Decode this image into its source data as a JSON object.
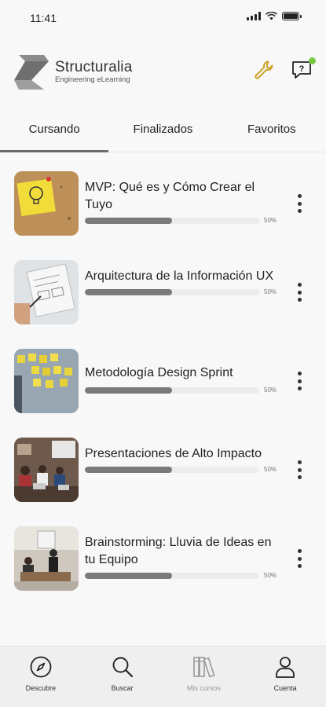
{
  "status_bar": {
    "time": "11:41"
  },
  "header": {
    "brand": "Structuralia",
    "tagline": "Engineering eLearning",
    "icons": [
      "wrench-icon",
      "help-chat-icon"
    ],
    "notification_color": "#7ac943"
  },
  "tabs": [
    {
      "label": "Cursando",
      "active": true
    },
    {
      "label": "Finalizados",
      "active": false
    },
    {
      "label": "Favoritos",
      "active": false
    }
  ],
  "courses": [
    {
      "title": "MVP: Qué es y Cómo Crear el Tuyo",
      "progress": 50,
      "progress_label": "50%",
      "thumb": "lightbulb-sticky-note"
    },
    {
      "title": "Arquitectura de la Información UX",
      "progress": 50,
      "progress_label": "50%",
      "thumb": "sketching-wireframes"
    },
    {
      "title": "Metodología Design Sprint",
      "progress": 50,
      "progress_label": "50%",
      "thumb": "sticky-notes-wall"
    },
    {
      "title": "Presentaciones de Alto Impacto",
      "progress": 50,
      "progress_label": "50%",
      "thumb": "classroom-presentation"
    },
    {
      "title": "Brainstorming: Lluvia de Ideas en tu Equipo",
      "progress": 50,
      "progress_label": "50%",
      "thumb": "office-meeting"
    }
  ],
  "bottom_nav": [
    {
      "label": "Descubre",
      "icon": "compass-icon"
    },
    {
      "label": "Buscar",
      "icon": "search-icon"
    },
    {
      "label": "Mis cursos",
      "icon": "books-icon"
    },
    {
      "label": "Cuenta",
      "icon": "user-icon"
    }
  ],
  "colors": {
    "accent_wrench": "#c9a227",
    "progress_fill": "#7a7a7a",
    "background": "#f8f8f8"
  }
}
